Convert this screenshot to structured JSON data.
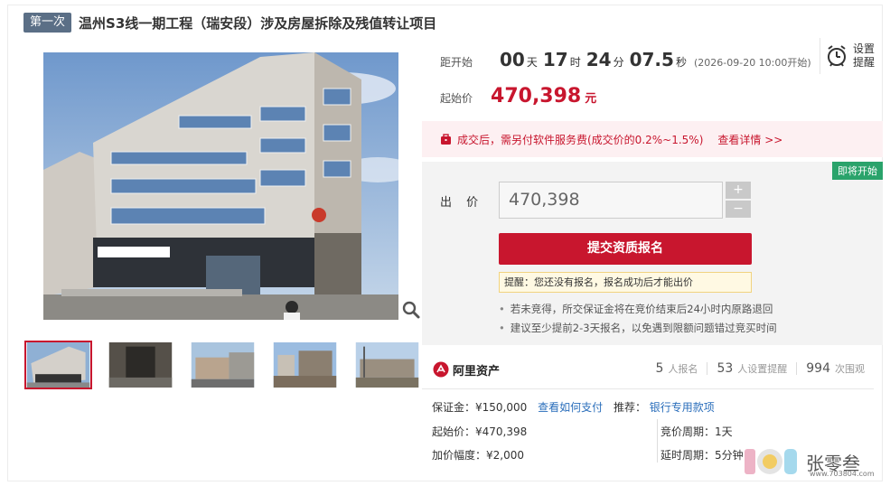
{
  "header": {
    "round_badge": "第一次",
    "title": "温州S3线一期工程（瑞安段）涉及房屋拆除及残值转让项目"
  },
  "countdown": {
    "label": "距开始",
    "days": "00",
    "days_unit": "天",
    "hours": "17",
    "hours_unit": "时",
    "minutes": "24",
    "minutes_unit": "分",
    "seconds": "07.5",
    "seconds_unit": "秒",
    "start_note": "(2026-09-20 10:00开始)"
  },
  "start_price": {
    "label": "起始价",
    "value": "470,398",
    "unit": "元"
  },
  "reminder": {
    "label": "设置提醒",
    "icon": "alarm-clock-icon"
  },
  "fee_notice": {
    "text": "成交后，需另付软件服务费(成交价的0.2%~1.5%)",
    "link": "查看详情 >>",
    "icon": "bag-icon"
  },
  "bid": {
    "status_tag": "即将开始",
    "label": "出 价",
    "input_value": "470,398",
    "plus": "+",
    "minus": "−",
    "submit_label": "提交资质报名",
    "tip": "提醒：您还没有报名，报名成功后才能出价",
    "notes": [
      "若未竞得，所交保证金将在竞价结束后24小时内原路退回",
      "建议至少提前2-3天报名，以免遇到限额问题错过竞买时间"
    ]
  },
  "platform": {
    "name": "阿里资产",
    "signups": "5",
    "signups_label": "人报名",
    "reminders": "53",
    "reminders_label": "人设置提醒",
    "views": "994",
    "views_label": "次围观"
  },
  "details": {
    "deposit_label": "保证金：",
    "deposit_value": "¥150,000",
    "pay_link": "查看如何支付",
    "recommend_label": "推荐：",
    "recommend_link": "银行专用款项",
    "start_label": "起始价：",
    "start_value": "¥470,398",
    "cycle_label": "竞价周期：",
    "cycle_value": "1天",
    "increment_label": "加价幅度：",
    "increment_value": "¥2,000",
    "delay_label": "延时周期：",
    "delay_value": "5分钟"
  },
  "watermark": {
    "name": "张零叁",
    "url": "www.703804.com"
  },
  "colors": {
    "accent": "#c8162e",
    "badge": "#5b6f86",
    "status_green": "#2aa36b",
    "link": "#2a6ebb"
  }
}
